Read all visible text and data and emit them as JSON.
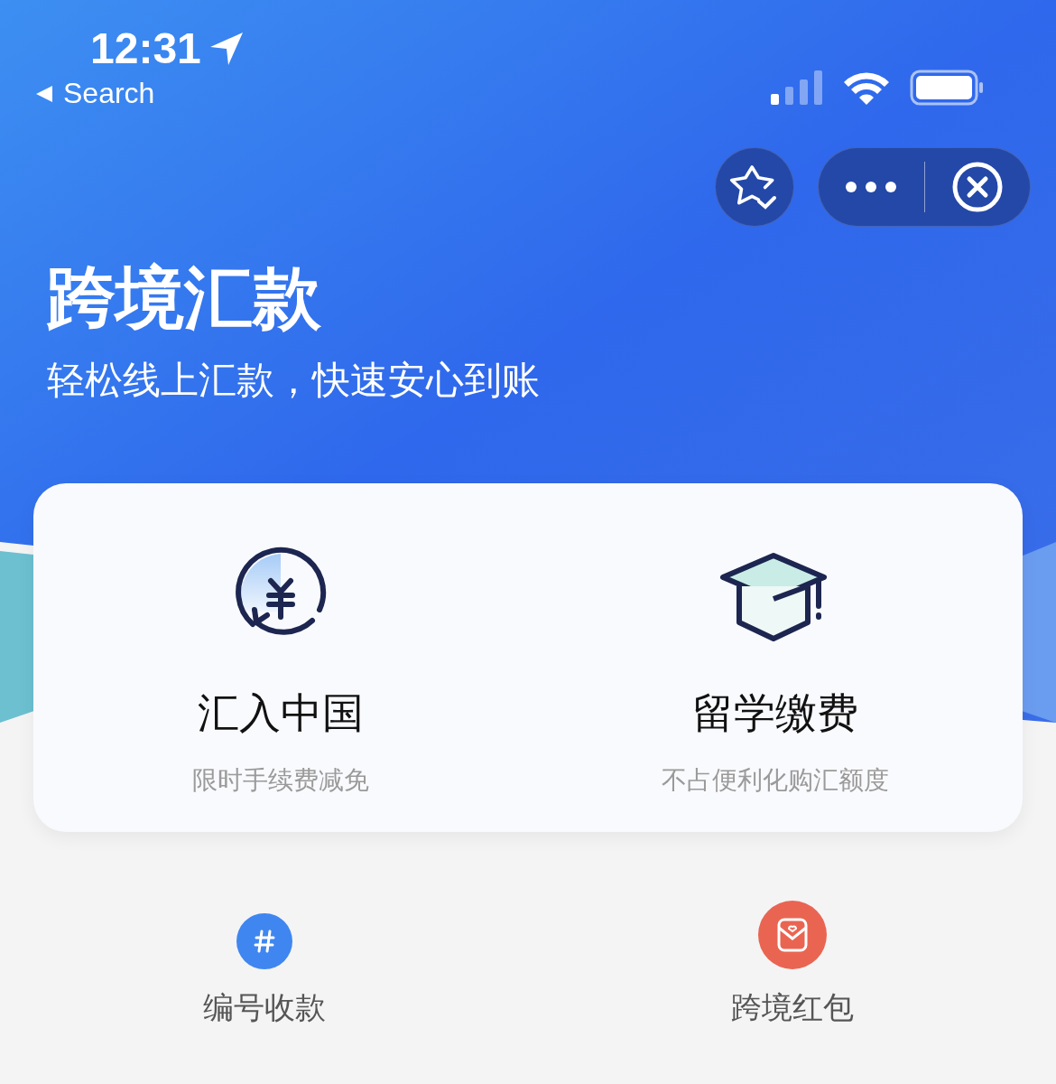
{
  "status_bar": {
    "time": "12:31",
    "back_label": "Search"
  },
  "header": {
    "title": "跨境汇款",
    "subtitle": "轻松线上汇款，快速安心到账"
  },
  "main_services": [
    {
      "kind": "remit",
      "title": "汇入中国",
      "description": "限时手续费减免"
    },
    {
      "kind": "tuition",
      "title": "留学缴费",
      "description": "不占便利化购汇额度"
    }
  ],
  "more_services": [
    {
      "kind": "number",
      "label": "编号收款",
      "color": "#3f86f0"
    },
    {
      "kind": "red-packet",
      "label": "跨境红包",
      "color": "#e96552"
    }
  ]
}
